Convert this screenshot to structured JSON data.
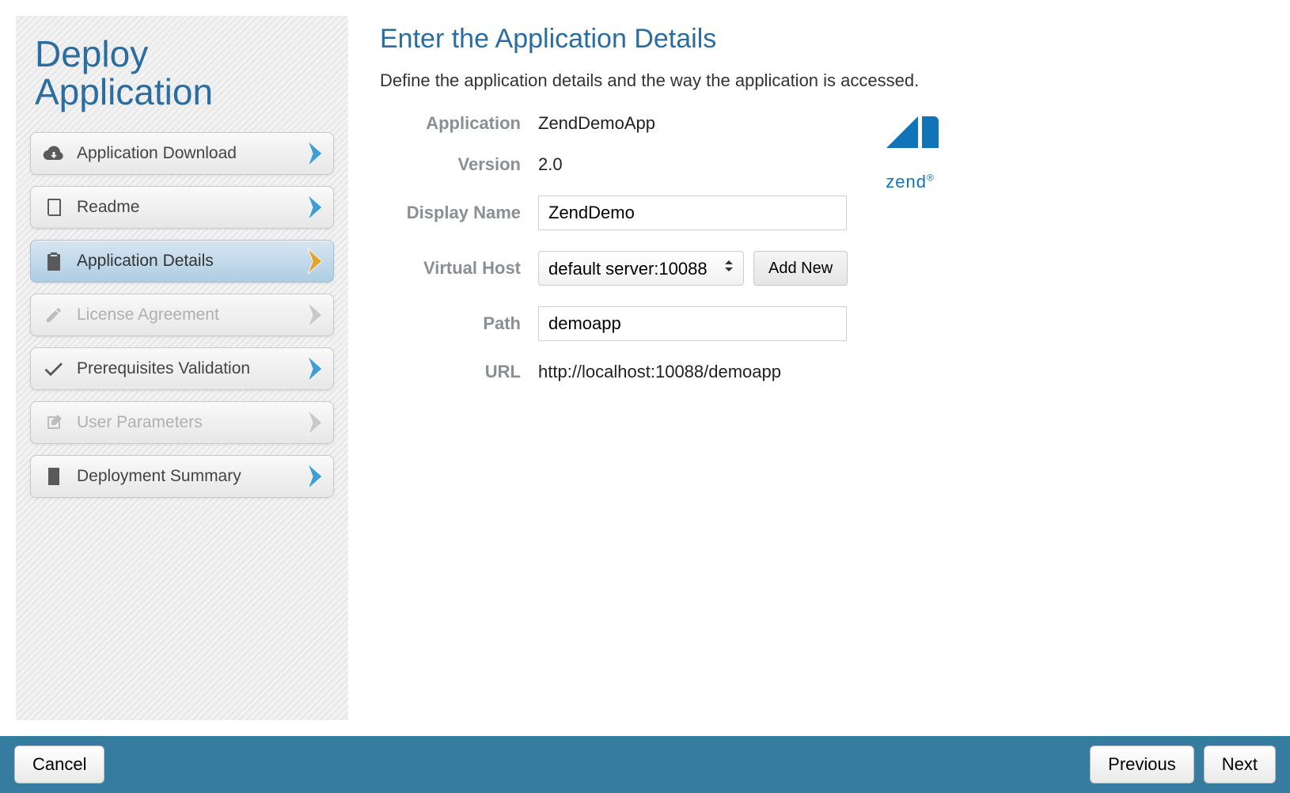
{
  "sidebar": {
    "title": "Deploy Application",
    "steps": [
      {
        "label": "Application Download",
        "icon": "cloud-download-icon",
        "state": "done"
      },
      {
        "label": "Readme",
        "icon": "book-icon",
        "state": "done"
      },
      {
        "label": "Application Details",
        "icon": "clipboard-icon",
        "state": "active"
      },
      {
        "label": "License Agreement",
        "icon": "pencil-icon",
        "state": "disabled"
      },
      {
        "label": "Prerequisites Validation",
        "icon": "check-icon",
        "state": "done"
      },
      {
        "label": "User Parameters",
        "icon": "edit-square-icon",
        "state": "disabled"
      },
      {
        "label": "Deployment Summary",
        "icon": "list-icon",
        "state": "done"
      }
    ]
  },
  "main": {
    "title": "Enter the Application Details",
    "description": "Define the application details and the way the application is accessed.",
    "labels": {
      "application": "Application",
      "version": "Version",
      "display_name": "Display Name",
      "virtual_host": "Virtual Host",
      "path": "Path",
      "url": "URL"
    },
    "application": "ZendDemoApp",
    "version": "2.0",
    "display_name": "ZendDemo",
    "virtual_host_selected": "default server:10088",
    "add_new_label": "Add New",
    "path": "demoapp",
    "url": "http://localhost:10088/demoapp",
    "logo_text": "zend",
    "logo_color": "#1274b8"
  },
  "footer": {
    "cancel": "Cancel",
    "previous": "Previous",
    "next": "Next"
  }
}
